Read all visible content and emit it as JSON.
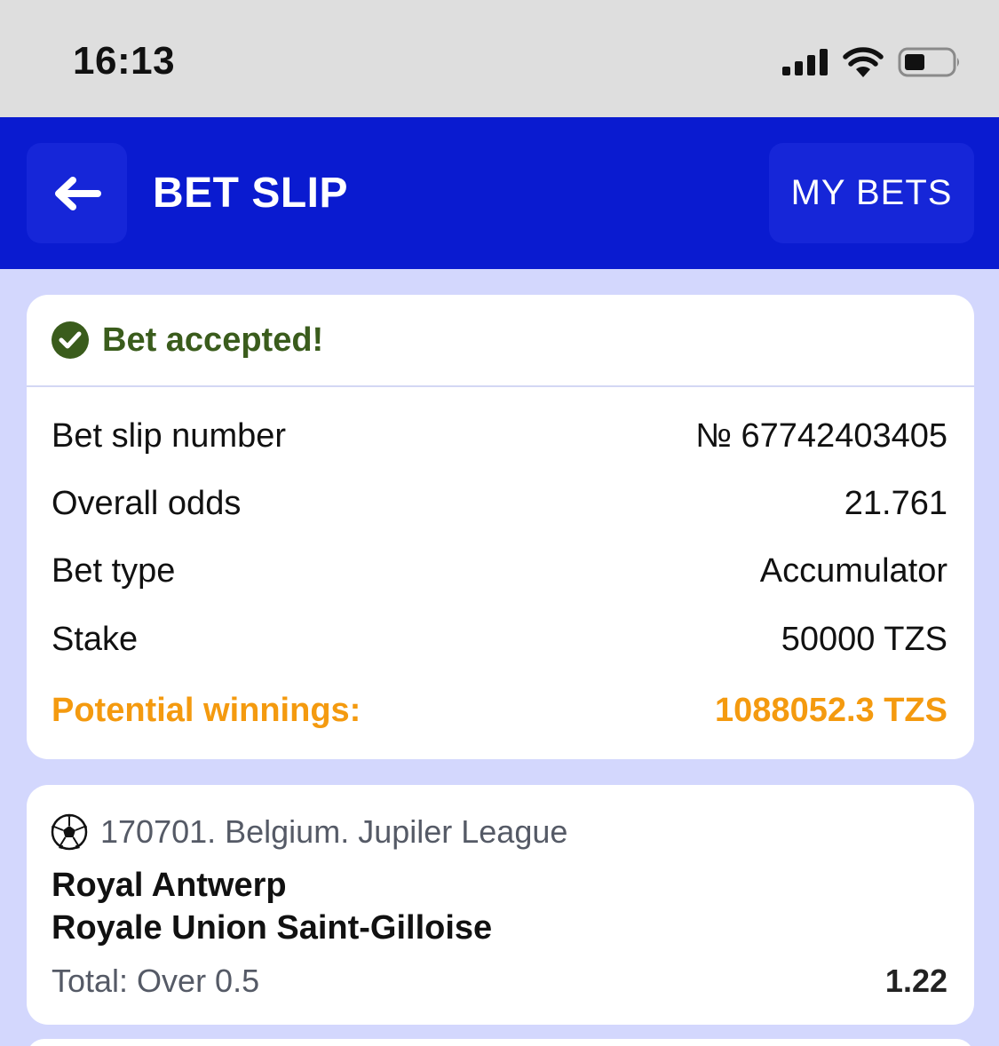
{
  "status_bar": {
    "time": "16:13",
    "icons": [
      "signal-icon",
      "wifi-icon",
      "battery-icon"
    ]
  },
  "header": {
    "title": "BET SLIP",
    "back_icon": "arrow-left-icon",
    "my_bets_label": "MY BETS",
    "color": "#0a1bd0"
  },
  "summary": {
    "status_icon": "check-circle-icon",
    "status_text": "Bet accepted!",
    "rows": [
      {
        "label": "Bet slip number",
        "value": "№ 67742403405"
      },
      {
        "label": "Overall odds",
        "value": "21.761"
      },
      {
        "label": "Bet type",
        "value": "Accumulator"
      },
      {
        "label": "Stake",
        "value": "50000 TZS"
      }
    ],
    "winnings": {
      "label": "Potential winnings:",
      "value": "1088052.3 TZS",
      "color": "#f49a0f"
    }
  },
  "event": {
    "sport_icon": "soccer-ball-icon",
    "league": "170701. Belgium. Jupiler League",
    "home_team": "Royal Antwerp",
    "away_team": "Royale Union Saint-Gilloise",
    "market": "Total: Over 0.5",
    "odd": "1.22"
  }
}
